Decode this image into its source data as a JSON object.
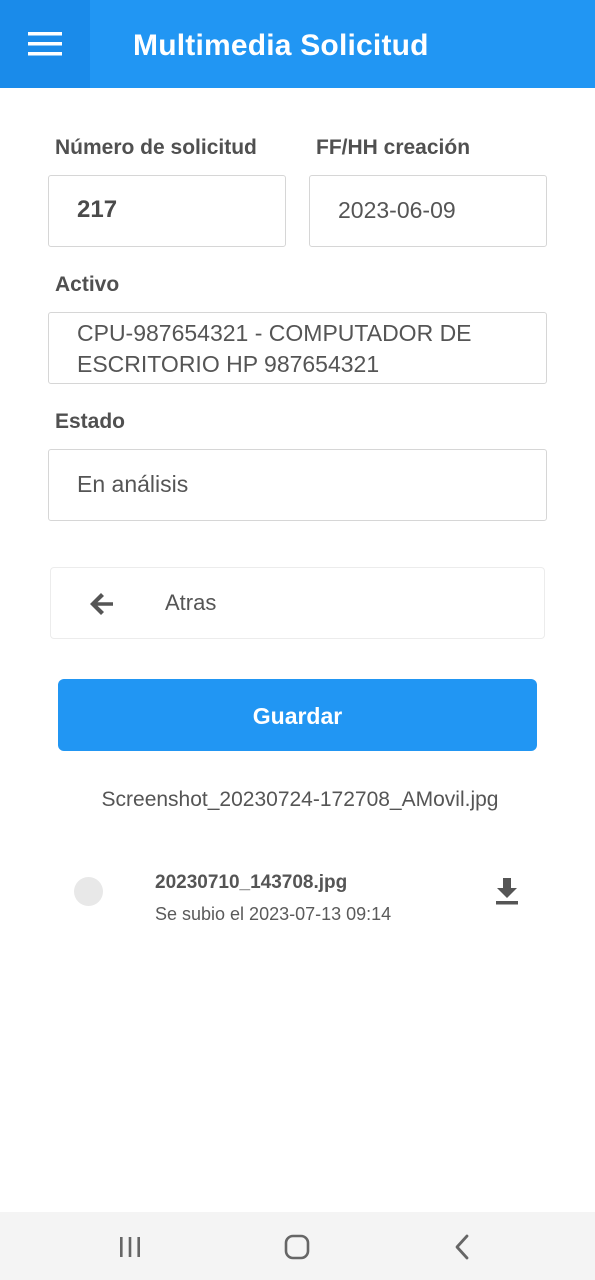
{
  "header": {
    "title": "Multimedia Solicitud",
    "menu_icon": "hamburger-menu-icon"
  },
  "form": {
    "request_number": {
      "label": "Número de solicitud",
      "value": "217"
    },
    "created": {
      "label": "FF/HH creación",
      "value": "2023-06-09"
    },
    "asset": {
      "label": "Activo",
      "value_line1": "CPU-987654321 - COMPUTADOR DE",
      "value_line2": "ESCRITORIO HP 987654321"
    },
    "status": {
      "label": "Estado",
      "value": "En análisis"
    }
  },
  "actions": {
    "back_label": "Atras",
    "back_icon": "arrow-left-icon",
    "save_label": "Guardar"
  },
  "selected_file": "Screenshot_20230724-172708_AMovil.jpg",
  "files": [
    {
      "name": "20230710_143708.jpg",
      "uploaded": "Se subio el 2023-07-13 09:14",
      "icon": "download-icon"
    }
  ],
  "system_nav": {
    "recents_icon": "recents-icon",
    "home_icon": "home-icon",
    "back_icon": "nav-back-icon"
  },
  "colors": {
    "primary": "#2196f3",
    "primary_dark": "#1a8bea"
  }
}
